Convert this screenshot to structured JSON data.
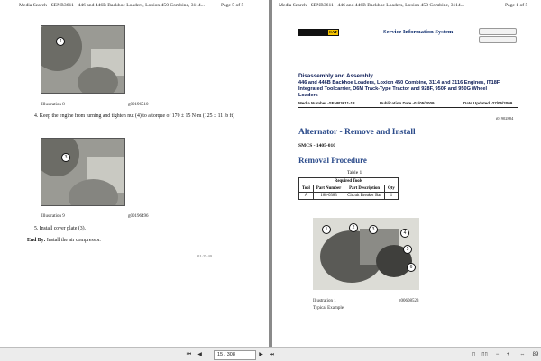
{
  "left_page": {
    "header": "Media Search - SENR3611 - 446 and 446B Backhoe Loaders, Loxion 450 Combine, 3114...",
    "page_label": "Page 5 of 5",
    "illus8": {
      "callout": "4",
      "caption": "Illustration 8",
      "code": "g00196510"
    },
    "step4": "4.   Keep the engine from turning and tighten nut (4) to a torque of 170 ± 15 N·m (125 ± 11 lb ft)",
    "illus9": {
      "callout": "3",
      "caption": "Illustration 9",
      "code": "g00196496"
    },
    "step5": "5.   Install cover plate (3).",
    "end_by_label": "End By:",
    "end_by_text": "Install the air compressor.",
    "footer_code": "01:25:40"
  },
  "right_page": {
    "header": "Media Search - SENR3611 - 446 and 446B Backhoe Loaders, Loxion 450 Combine, 3114...",
    "page_label": "Page 1 of 5",
    "logo_text": "FINNING",
    "logo_cat": "CAT",
    "sis_title": "Service Information System",
    "doc_title_1": "Disassembly and Assembly",
    "doc_title_2": "446 and 446B Backhoe Loaders, Loxion 450 Combine, 3114 and 3116 Engines, IT18F",
    "doc_title_3": "Integrated Toolcarrier, D6M Track-Type Tractor and 928F, 950F and 950G Wheel",
    "doc_title_4": "Loaders",
    "media_label": "Media Number -SENR3611-18",
    "pub_label": "Publication Date -01/05/2009",
    "upd_label": "Date Updated -27/05/2009",
    "doc_id": "i01902884",
    "section_title": "Alternator - Remove and Install",
    "smcs": "SMCS - 1405-010",
    "removal_title": "Removal Procedure",
    "table_caption": "Table 1",
    "table_title": "Required Tools",
    "table_headers": [
      "Tool",
      "Part Number",
      "Part Description",
      "Qty"
    ],
    "table_row": [
      "A",
      "168-0383",
      "Circuit Breaker Bar",
      "1"
    ],
    "illus1_callouts": [
      "1",
      "2",
      "3",
      "4",
      "5",
      "6"
    ],
    "illus1_caption": "Illustration 1",
    "illus1_code": "g00608523",
    "illus1_sub": "Typical Example"
  },
  "toolbar": {
    "page_field": "15 / 308",
    "right_value": "89"
  }
}
